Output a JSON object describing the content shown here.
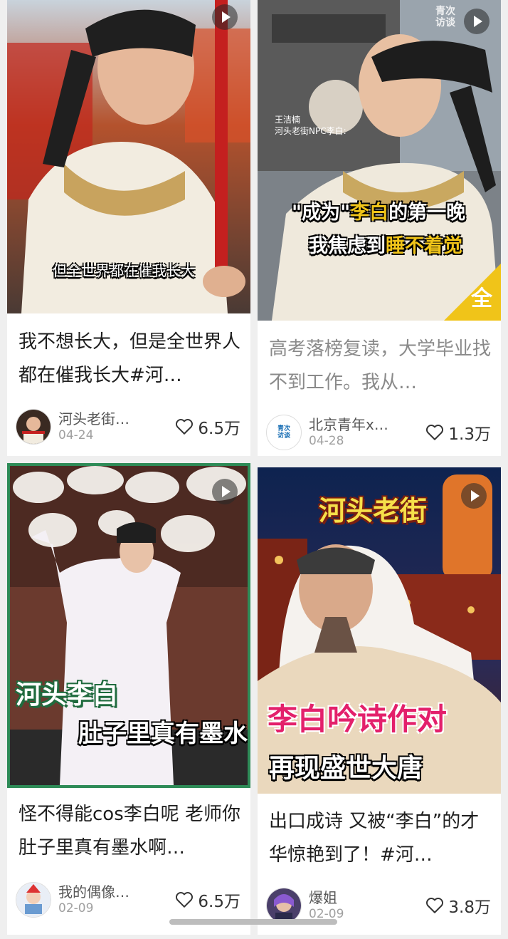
{
  "cards": [
    {
      "title": "我不想长大，但是全世界人都在催我长大#河…",
      "author": "河头老街…",
      "date": "04-24",
      "likes": "6.5万",
      "caption": "但全世界都在催我长大"
    },
    {
      "title": "高考落榜复读，大学毕业找不到工作。我从…",
      "author": "北京青年x…",
      "date": "04-28",
      "likes": "1.3万",
      "overlay_small": "王洁楠\n河头老街NPC李白:",
      "overlay_line1_a": "\"成为\"",
      "overlay_line1_b": "李白",
      "overlay_line1_c": "的第一晚",
      "overlay_line2_a": "我焦虑到",
      "overlay_line2_b": "睡不着觉",
      "badge": "全",
      "logo": "青次\n访谈",
      "avatar_text": "青次\n访谈"
    },
    {
      "title": "怪不得能cos李白呢 老师你肚子里真有墨水啊…",
      "author": "我的偶像…",
      "date": "02-09",
      "likes": "6.5万",
      "overlay_line1": "河头李白",
      "overlay_line2": "肚子里真有墨水"
    },
    {
      "title": "出口成诗 又被“李白”的才华惊艳到了！#河…",
      "author": "爆姐",
      "date": "02-09",
      "likes": "3.8万",
      "overlay_top": "河头老街",
      "overlay_mid": "李白吟诗作对",
      "overlay_bot": "再现盛世大唐"
    }
  ],
  "colors": {
    "accent_green": "#2e8b57",
    "accent_yellow": "#f0c419",
    "heart": "#333333"
  }
}
